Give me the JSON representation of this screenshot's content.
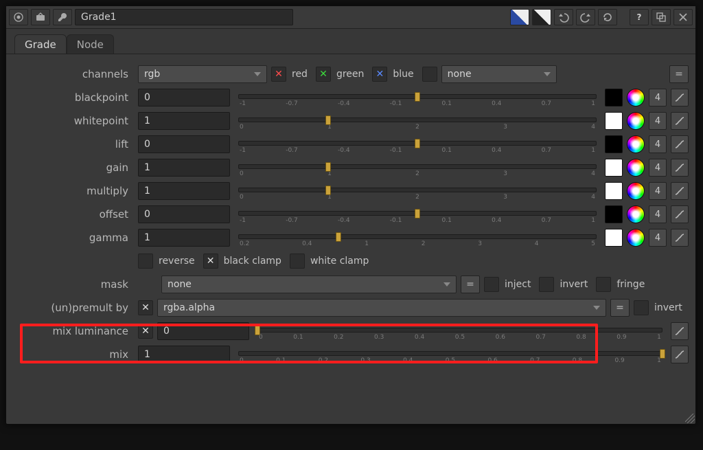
{
  "header": {
    "node_name": "Grade1"
  },
  "tabs": [
    "Grade",
    "Node"
  ],
  "active_tab": 0,
  "channels": {
    "label": "channels",
    "dropdown": "rgb",
    "red": "red",
    "green": "green",
    "blue": "blue",
    "alpha_dropdown": "none",
    "equal": "="
  },
  "sliders": [
    {
      "key": "blackpoint",
      "label": "blackpoint",
      "value": "0",
      "ticks": [
        "-1",
        "-0.7",
        "-0.4",
        "-0.1",
        "0.1",
        "0.4",
        "0.7",
        "1"
      ],
      "handlePct": 50,
      "swatch": "black"
    },
    {
      "key": "whitepoint",
      "label": "whitepoint",
      "value": "1",
      "ticks": [
        "0",
        "1",
        "2",
        "3",
        "4"
      ],
      "handlePct": 25,
      "swatch": "white"
    },
    {
      "key": "lift",
      "label": "lift",
      "value": "0",
      "ticks": [
        "-1",
        "-0.7",
        "-0.4",
        "-0.1",
        "0.1",
        "0.4",
        "0.7",
        "1"
      ],
      "handlePct": 50,
      "swatch": "black"
    },
    {
      "key": "gain",
      "label": "gain",
      "value": "1",
      "ticks": [
        "0",
        "1",
        "2",
        "3",
        "4"
      ],
      "handlePct": 25,
      "swatch": "white"
    },
    {
      "key": "multiply",
      "label": "multiply",
      "value": "1",
      "ticks": [
        "0",
        "1",
        "2",
        "3",
        "4"
      ],
      "handlePct": 25,
      "swatch": "white"
    },
    {
      "key": "offset",
      "label": "offset",
      "value": "0",
      "ticks": [
        "-1",
        "-0.7",
        "-0.4",
        "-0.1",
        "0.1",
        "0.4",
        "0.7",
        "1"
      ],
      "handlePct": 50,
      "swatch": "black"
    },
    {
      "key": "gamma",
      "label": "gamma",
      "value": "1",
      "ticks": [
        "0.2",
        "0.4",
        "1",
        "2",
        "3",
        "4",
        "5"
      ],
      "handlePct": 28,
      "swatch": "white"
    }
  ],
  "slider_num4": "4",
  "clamp": {
    "reverse": "reverse",
    "black_clamp": "black clamp",
    "white_clamp": "white clamp"
  },
  "mask": {
    "label": "mask",
    "dropdown": "none",
    "equal": "=",
    "inject": "inject",
    "invert": "invert",
    "fringe": "fringe"
  },
  "unpremult": {
    "label": "(un)premult by",
    "dropdown": "rgba.alpha",
    "equal": "=",
    "invert": "invert"
  },
  "mixlum": {
    "label": "mix luminance",
    "value": "0",
    "ticks": [
      "0",
      "0.1",
      "0.2",
      "0.3",
      "0.4",
      "0.5",
      "0.6",
      "0.7",
      "0.8",
      "0.9",
      "1"
    ],
    "handlePct": 0
  },
  "mix": {
    "label": "mix",
    "value": "1",
    "ticks": [
      "0",
      "0.1",
      "0.2",
      "0.3",
      "0.4",
      "0.5",
      "0.6",
      "0.7",
      "0.8",
      "0.9",
      "1"
    ],
    "handlePct": 100
  }
}
